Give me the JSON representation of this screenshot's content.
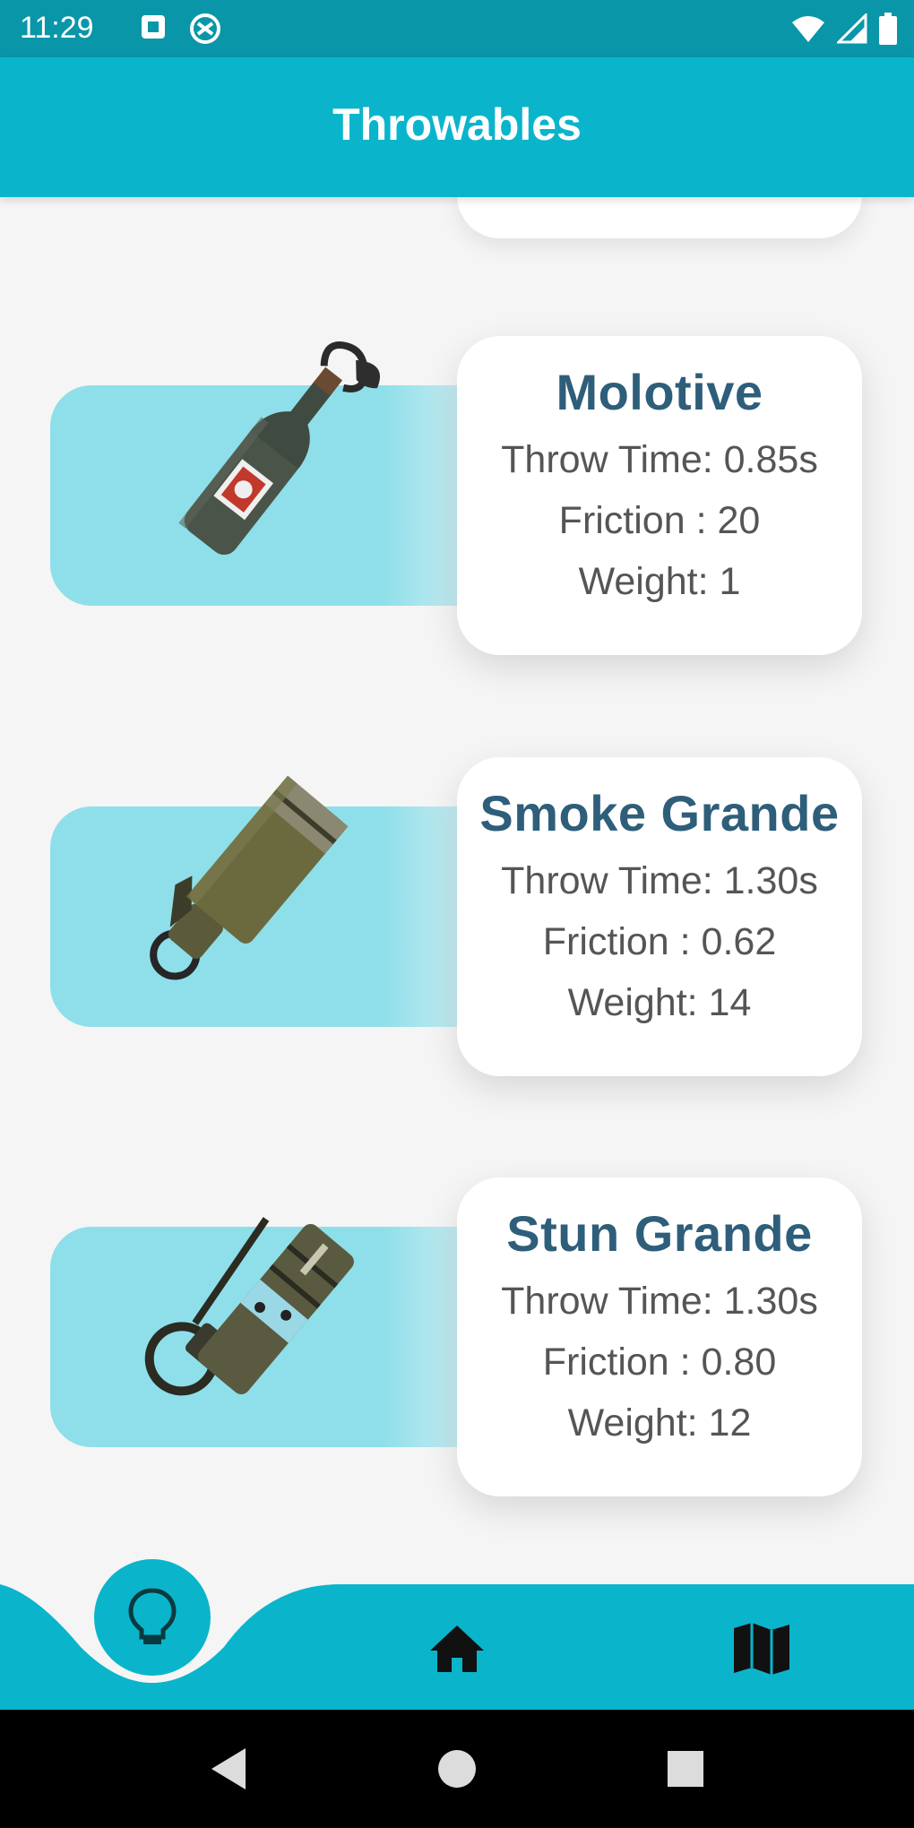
{
  "status_bar": {
    "time": "11:29",
    "left_icons": [
      "notification-square-icon",
      "settings-sync-icon"
    ],
    "right_icons": [
      "wifi-icon",
      "signal-icon",
      "battery-icon"
    ]
  },
  "app_bar": {
    "title": "Throwables"
  },
  "items": [
    {
      "name": "Molotive",
      "throw_time": "Throw Time: 0.85s",
      "friction": "Friction : 20",
      "weight": "Weight: 1",
      "image": "molotov-cocktail-image"
    },
    {
      "name": "Smoke Grande",
      "throw_time": "Throw Time: 1.30s",
      "friction": "Friction : 0.62",
      "weight": "Weight: 14",
      "image": "smoke-grenade-image"
    },
    {
      "name": "Stun Grande",
      "throw_time": "Throw Time: 1.30s",
      "friction": "Friction : 0.80",
      "weight": "Weight: 12",
      "image": "stun-grenade-image"
    }
  ],
  "bottom_nav": {
    "items": [
      "lightbulb-icon",
      "home-icon",
      "map-icon"
    ],
    "active": "lightbulb-icon"
  },
  "system_nav": [
    "back-icon",
    "home-circle-icon",
    "recents-icon"
  ],
  "colors": {
    "status_bar": "#0996a8",
    "app_bar": "#0ab5cc",
    "band": "#8edfea",
    "title_text": "#2e5e7a",
    "body_text": "#555555"
  }
}
